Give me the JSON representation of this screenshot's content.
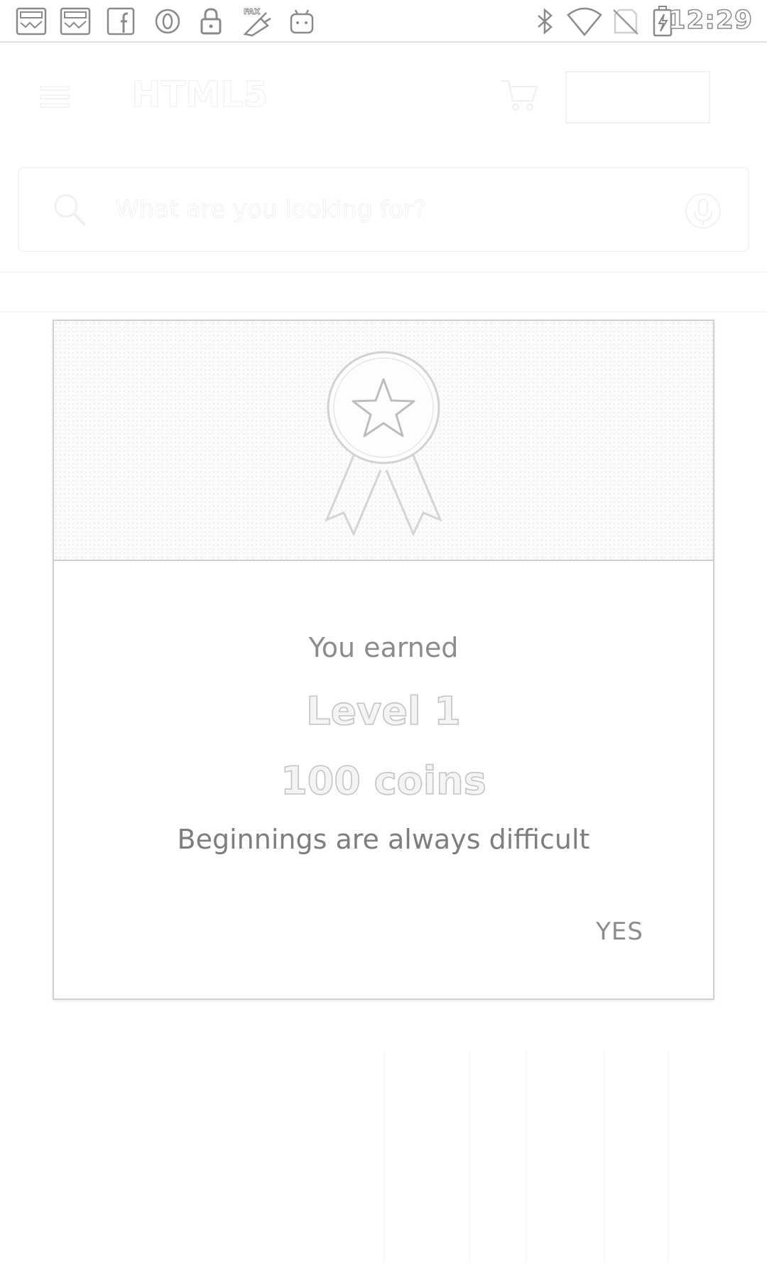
{
  "status_bar": {
    "time": "12:29",
    "notification_icons": [
      "news-icon",
      "news-icon",
      "facebook-icon",
      "circle-o-icon",
      "lock-icon",
      "fax-icon",
      "android-icon"
    ],
    "system_icons": [
      "bluetooth-icon",
      "wifi-icon",
      "no-sim-icon",
      "battery-charging-icon"
    ]
  },
  "background_app": {
    "toolbar_title": "HTML5",
    "search_placeholder": "What are you looking for?"
  },
  "dialog": {
    "icon": "award-ribbon-icon",
    "earned_label": "You earned",
    "level_text": "Level 1",
    "coins_text": "100 coins",
    "message": "Beginnings are always difficult",
    "confirm_label": "YES"
  }
}
